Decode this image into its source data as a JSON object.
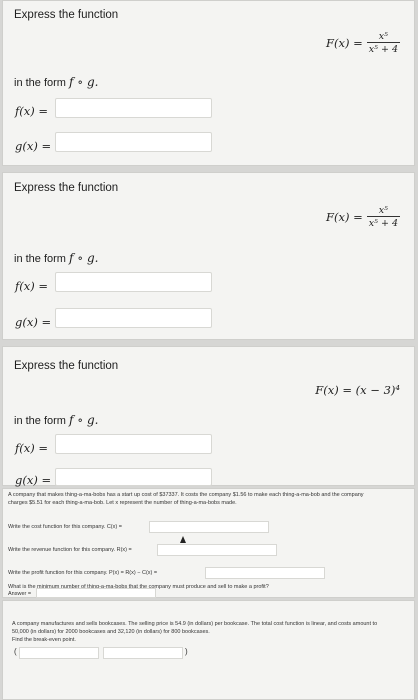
{
  "problem1": {
    "heading": "Express the function",
    "formula_lhs": "F(x) =",
    "formula_num": "x⁵",
    "formula_den": "x⁵ + 4",
    "form_prefix": "in the form",
    "form_expr": "f ∘ g.",
    "f_label": "f(x) =",
    "g_label": "g(x) ="
  },
  "problem2": {
    "heading": "Express the function",
    "formula_lhs": "F(x) =",
    "formula_num": "x⁵",
    "formula_den": "x⁵ + 4",
    "form_prefix": "in the form",
    "form_expr": "f ∘ g.",
    "f_label": "f(x) =",
    "g_label": "g(x) ="
  },
  "problem3": {
    "heading": "Express the function",
    "formula": "F(x) = (x − 3)⁴",
    "form_prefix": "in the form",
    "form_expr": "f ∘ g.",
    "f_label": "f(x) =",
    "g_label": "g(x) ="
  },
  "problem4": {
    "intro_line1": "A company that makes thing-a-ma-bobs has a start up cost of $37337. It costs the company $1.56 to make each thing-a-ma-bob and the company",
    "intro_line2": "charges $5.51 for each thing-a-ma-bob. Let x represent the number of thing-a-ma-bobs made.",
    "cost_label": "Write the cost function for this company. C(x) =",
    "revenue_label": "Write the revenue function for this company. R(x) =",
    "profit_label": "Write the profit function for this company. P(x) = R(x) − C(x) =",
    "min_label": "What is the minimum number of thing-a-ma-bobs that the company must produce and sell to make a profit?",
    "answer_label": "Answer ="
  },
  "problem5": {
    "intro_line1": "A company manufactures and sells bookcases. The selling price is 54.9 (in dollars) per bookcase. The total cost function is linear, and costs amount to",
    "intro_line2": "50,000 (in dollars) for 2000 bookcases and 32,120 (in dollars) for 800 bookcases.",
    "prompt": "Find the break-even point.",
    "paren_open": "(",
    "paren_close": ")"
  }
}
